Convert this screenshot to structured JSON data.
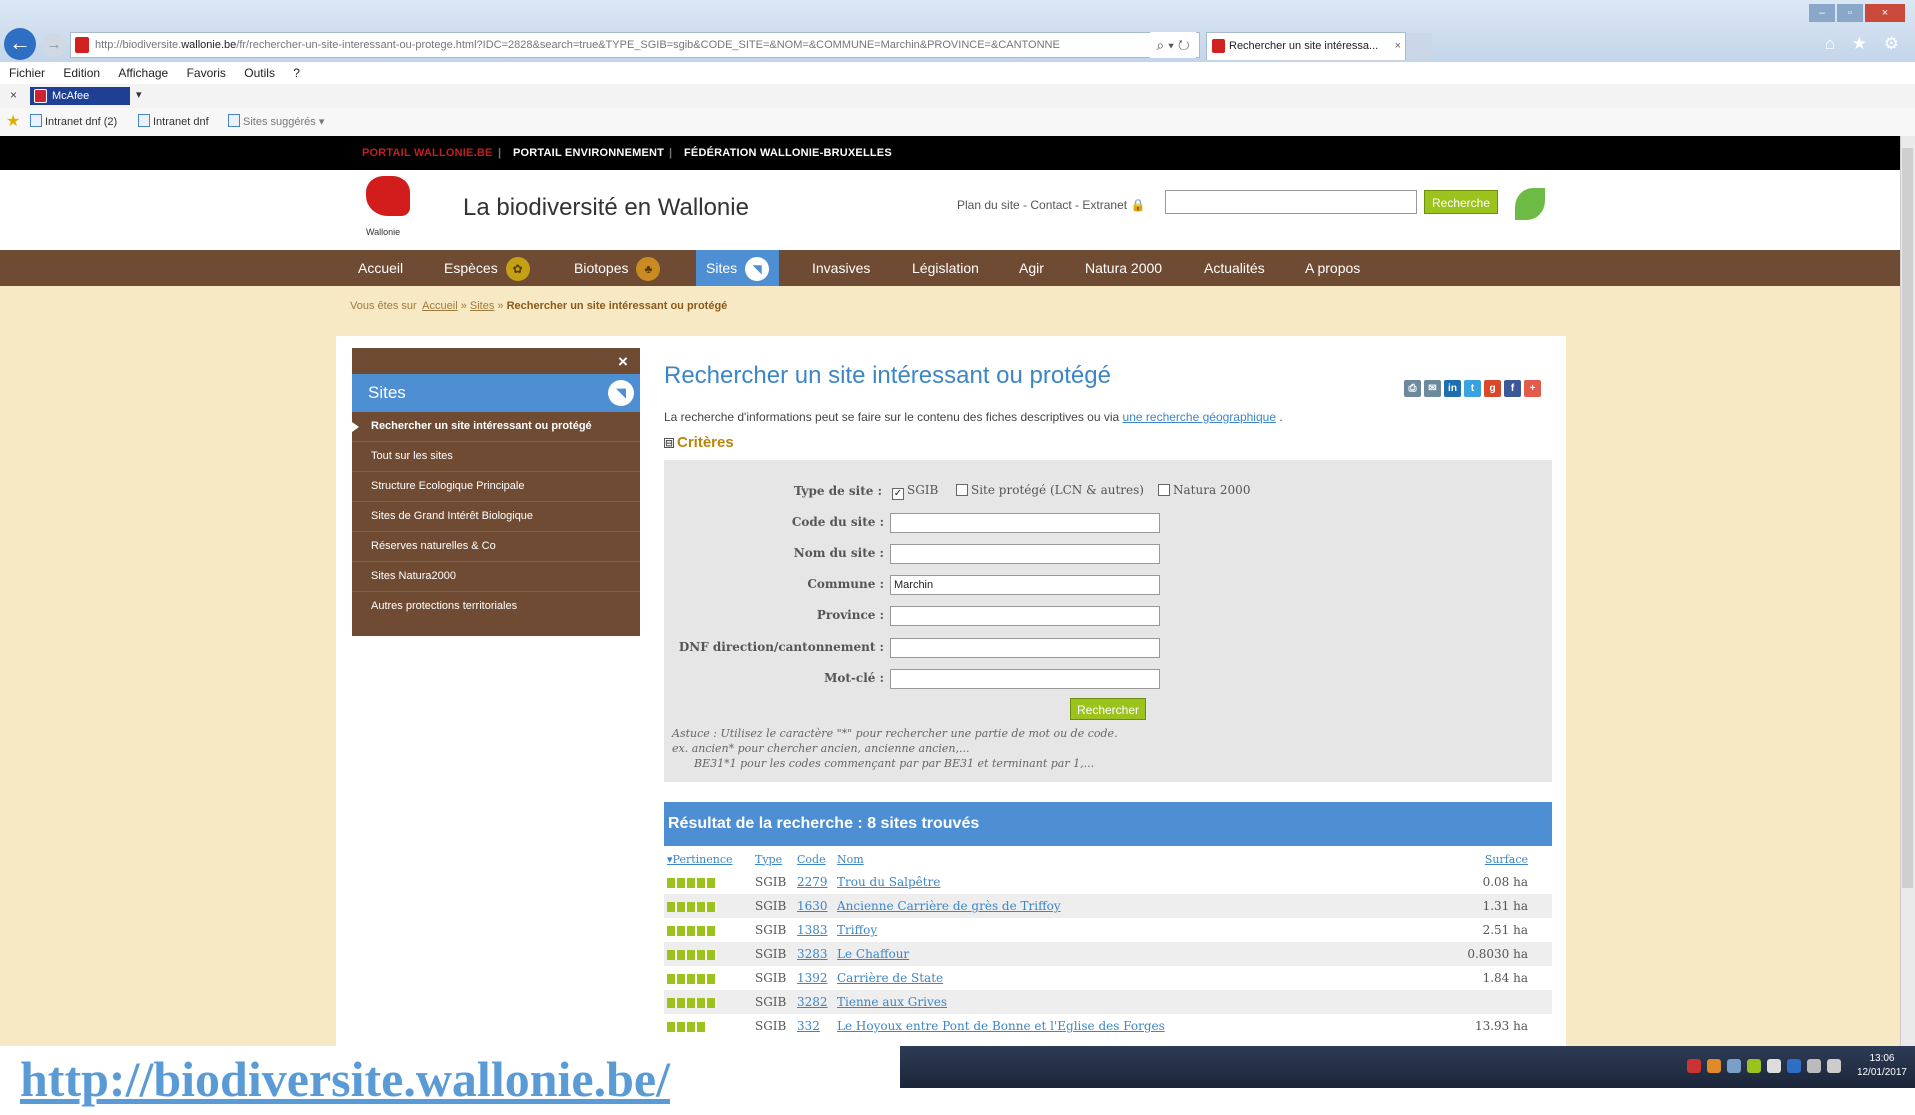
{
  "browser": {
    "url_prefix": "http://biodiversite.",
    "url_domain": "wallonie.be",
    "url_rest": "/fr/rechercher-un-site-interessant-ou-protege.html?IDC=2828&search=true&TYPE_SGIB=sgib&CODE_SITE=&NOM=&COMMUNE=Marchin&PROVINCE=&CANTONNE",
    "addr_icons": "⌕ ▾ ↻",
    "tab_title": "Rechercher un site intéressa...",
    "tab_close": "×",
    "win_min": "–",
    "win_max": "▫",
    "win_close": "×",
    "right_icons": "⌂ ★ ⚙",
    "back": "←",
    "forward": "→",
    "menu": [
      "Fichier",
      "Edition",
      "Affichage",
      "Favoris",
      "Outils",
      "?"
    ],
    "toolbar_close": "×",
    "mcafee_label": "McAfee",
    "mcafee_dropdown": "▾",
    "favorites": [
      "Intranet dnf (2)",
      "Intranet dnf",
      "Sites suggérés ▾"
    ]
  },
  "topbar": {
    "portail_wallonie": "PORTAIL WALLONIE.BE",
    "sep": "|",
    "portail_env": "PORTAIL ENVIRONNEMENT",
    "federation": "FÉDÉRATION WALLONIE-BRUXELLES"
  },
  "header": {
    "logo_caption": "Wallonie",
    "title": "La biodiversité en Wallonie",
    "links": "Plan du site - Contact - Extranet",
    "search_button": "Recherche"
  },
  "nav": [
    {
      "label": "Accueil"
    },
    {
      "label": "Espèces"
    },
    {
      "label": "Biotopes"
    },
    {
      "label": "Sites"
    },
    {
      "label": "Invasives"
    },
    {
      "label": "Législation"
    },
    {
      "label": "Agir"
    },
    {
      "label": "Natura 2000"
    },
    {
      "label": "Actualités"
    },
    {
      "label": "A propos"
    }
  ],
  "breadcrumb": {
    "prefix": "Vous êtes sur",
    "home": "Accueil",
    "sep": "»",
    "section": "Sites",
    "current": "Rechercher un site intéressant ou protégé"
  },
  "sidebar": {
    "close": "×",
    "title": "Sites",
    "items": [
      "Rechercher un site intéressant ou protégé",
      "Tout sur les sites",
      "Structure Ecologique Principale",
      "Sites de Grand Intérêt Biologique",
      "Réserves naturelles & Co",
      "Sites Natura2000",
      "Autres protections territoriales"
    ]
  },
  "main": {
    "title": "Rechercher un site intéressant ou protégé",
    "intro_text": "La recherche d'informations peut se faire sur le contenu des fiches descriptives ou via",
    "intro_link": "une recherche géographique",
    "intro_end": ".",
    "criteria_toggle": "⊟",
    "criteria_title": "Critères"
  },
  "form": {
    "type_label": "Type de site :",
    "type_options": [
      {
        "label": "SGIB",
        "checked": true
      },
      {
        "label": "Site protégé (LCN & autres)",
        "checked": false
      },
      {
        "label": "Natura 2000",
        "checked": false
      }
    ],
    "check_mark": "✓",
    "code_label": "Code du site :",
    "code_value": "",
    "nom_label": "Nom du site :",
    "nom_value": "",
    "commune_label": "Commune :",
    "commune_value": "Marchin",
    "province_label": "Province :",
    "province_value": "",
    "dnf_label": "DNF direction/cantonnement :",
    "dnf_value": "",
    "motcle_label": "Mot-clé :",
    "motcle_value": "",
    "submit": "Rechercher",
    "tip_line1": "Astuce : Utilisez le caractère \"*\" pour rechercher une partie de mot ou de code.",
    "tip_line2": "ex. ancien* pour chercher ancien, ancienne ancien,...",
    "tip_line3": "BE31*1 pour les codes commençant par par BE31 et terminant par 1,..."
  },
  "results": {
    "title": "Résultat de la recherche : 8 sites trouvés",
    "columns": {
      "pertinence": "Pertinence",
      "type": "Type",
      "code": "Code",
      "nom": "Nom",
      "surface": "Surface"
    },
    "rows": [
      {
        "pertinence": 5,
        "type": "SGIB",
        "code": "2279",
        "name": "Trou du Salpêtre",
        "surface": "0.08 ha"
      },
      {
        "pertinence": 5,
        "type": "SGIB",
        "code": "1630",
        "name": "Ancienne Carrière de grès de Triffoy",
        "surface": "1.31 ha"
      },
      {
        "pertinence": 5,
        "type": "SGIB",
        "code": "1383",
        "name": "Triffoy",
        "surface": "2.51 ha"
      },
      {
        "pertinence": 5,
        "type": "SGIB",
        "code": "3283",
        "name": "Le Chaffour",
        "surface": "0.8030 ha"
      },
      {
        "pertinence": 5,
        "type": "SGIB",
        "code": "1392",
        "name": "Carrière de State",
        "surface": "1.84 ha"
      },
      {
        "pertinence": 5,
        "type": "SGIB",
        "code": "3282",
        "name": "Tienne aux Grives",
        "surface": ""
      },
      {
        "pertinence": 4,
        "type": "SGIB",
        "code": "332",
        "name": "Le Hoyoux entre Pont de Bonne et l'Eglise des Forges",
        "surface": "13.93 ha"
      }
    ]
  },
  "taskbar": {
    "time": "13:06",
    "date": "12/01/2017"
  },
  "caption_url": "http://biodiversite.wallonie.be/",
  "colors": {
    "brand_brown": "#6f4b33",
    "accent_blue": "#4e8fd4",
    "accent_green": "#9cc21e",
    "page_bg": "#f7e9c4"
  }
}
